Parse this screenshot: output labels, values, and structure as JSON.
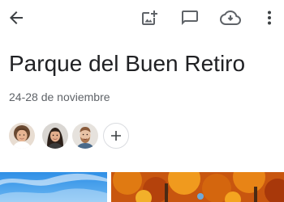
{
  "album": {
    "title": "Parque del Buen Retiro",
    "dates": "24-28 de noviembre"
  },
  "toolbar": {
    "icons": [
      "arrow-back-icon",
      "add-photo-icon",
      "comment-icon",
      "cloud-download-icon",
      "more-vert-icon"
    ]
  },
  "people": {
    "avatars": [
      "woman-curly-hair-avatar",
      "woman-dark-hair-avatar",
      "man-beard-avatar"
    ],
    "add_icon": "plus-icon"
  },
  "photos": [
    {
      "subject": "blue-sky-photo"
    },
    {
      "subject": "autumn-trees-photo"
    }
  ],
  "colors": {
    "icon": "#5f6368",
    "text_primary": "#202124",
    "text_secondary": "#5f6368",
    "border": "#dadce0"
  }
}
